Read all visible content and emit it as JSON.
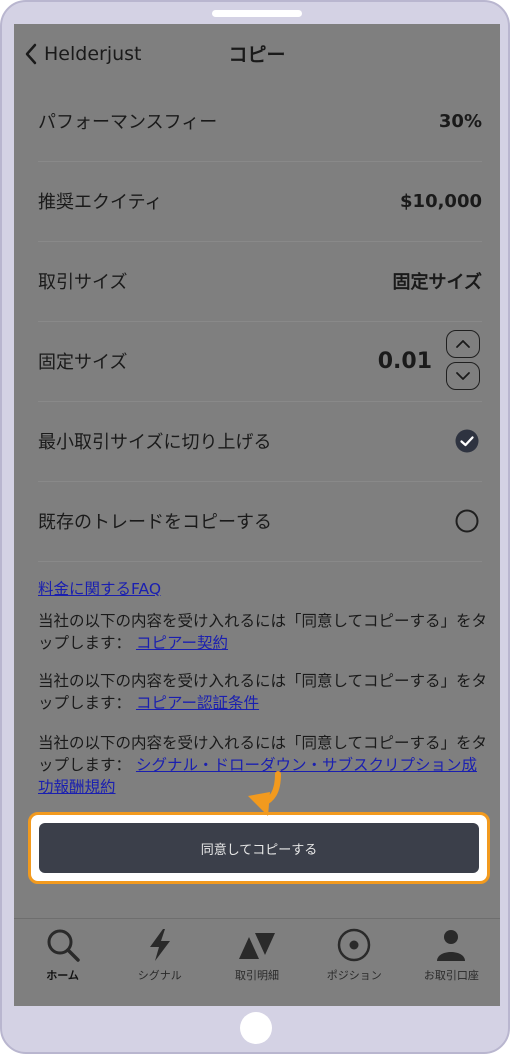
{
  "navbar": {
    "back_label": "Helderjust",
    "title": "コピー"
  },
  "settings": {
    "performance_fee": {
      "label": "パフォーマンスフィー",
      "value": "30%"
    },
    "recommended_equity": {
      "label": "推奨エクイティ",
      "value": "$10,000"
    },
    "trade_size": {
      "label": "取引サイズ",
      "value": "固定サイズ"
    },
    "fixed_size": {
      "label": "固定サイズ",
      "value": "0.01"
    },
    "round_up_min": {
      "label": "最小取引サイズに切り上げる",
      "checked": true
    },
    "copy_existing": {
      "label": "既存のトレードをコピーする",
      "checked": false
    }
  },
  "info": {
    "faq_link": "料金に関するFAQ",
    "para1_text": "当社の以下の内容を受け入れるには「同意してコピーする」をタップします：",
    "para1_link": "コピアー契約",
    "para2_text": "当社の以下の内容を受け入れるには「同意してコピーする」をタップします：",
    "para2_link": "コピアー認証条件",
    "para3_text": "当社の以下の内容を受け入れるには「同意してコピーする」をタップします：",
    "para3_link": "シグナル・ドローダウン・サブスクリプション成功報酬規約"
  },
  "cta": {
    "label": "同意してコピーする"
  },
  "tabs": [
    {
      "label": "ホーム",
      "icon": "search-icon",
      "active": true
    },
    {
      "label": "シグナル",
      "icon": "lightning-icon",
      "active": false
    },
    {
      "label": "取引明細",
      "icon": "up-down-triangles-icon",
      "active": false
    },
    {
      "label": "ポジション",
      "icon": "target-circle-icon",
      "active": false
    },
    {
      "label": "お取引口座",
      "icon": "person-icon",
      "active": false
    }
  ],
  "colors": {
    "highlight": "#f29a1e",
    "button": "#3b3f4a",
    "link": "#1a1fb0"
  }
}
